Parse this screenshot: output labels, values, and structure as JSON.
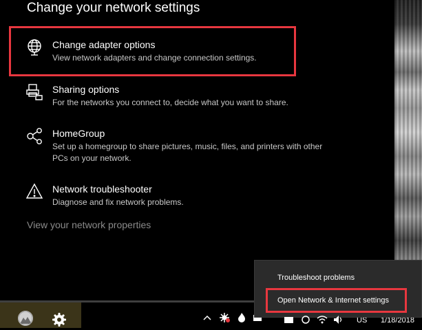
{
  "heading": "Change your network settings",
  "options": [
    {
      "title": "Change adapter options",
      "description": "View network adapters and change connection settings.",
      "icon": "globe-icon"
    },
    {
      "title": "Sharing options",
      "description": "For the networks you connect to, decide what you want to share.",
      "icon": "sharing-icon"
    },
    {
      "title": "HomeGroup",
      "description": "Set up a homegroup to share pictures, music, files, and printers with other PCs on your network.",
      "icon": "homegroup-icon"
    },
    {
      "title": "Network troubleshooter",
      "description": "Diagnose and fix network problems.",
      "icon": "warning-icon"
    }
  ],
  "view_properties_link": "View your network properties",
  "context_menu": {
    "items": [
      "Troubleshoot problems",
      "Open Network & Internet settings"
    ]
  },
  "taskbar": {
    "language": "US",
    "date": "1/18/2018",
    "icons": [
      "user-icon",
      "gear-icon",
      "chevron-up-icon",
      "network-status-icon",
      "flame-icon",
      "taskbar-app-icon",
      "onedrive-icon",
      "sync-icon",
      "wifi-icon",
      "volume-icon"
    ]
  },
  "colors": {
    "highlight": "#e8373f",
    "start_area": "#3b3419",
    "flyout_bg": "#2b2b2b"
  }
}
